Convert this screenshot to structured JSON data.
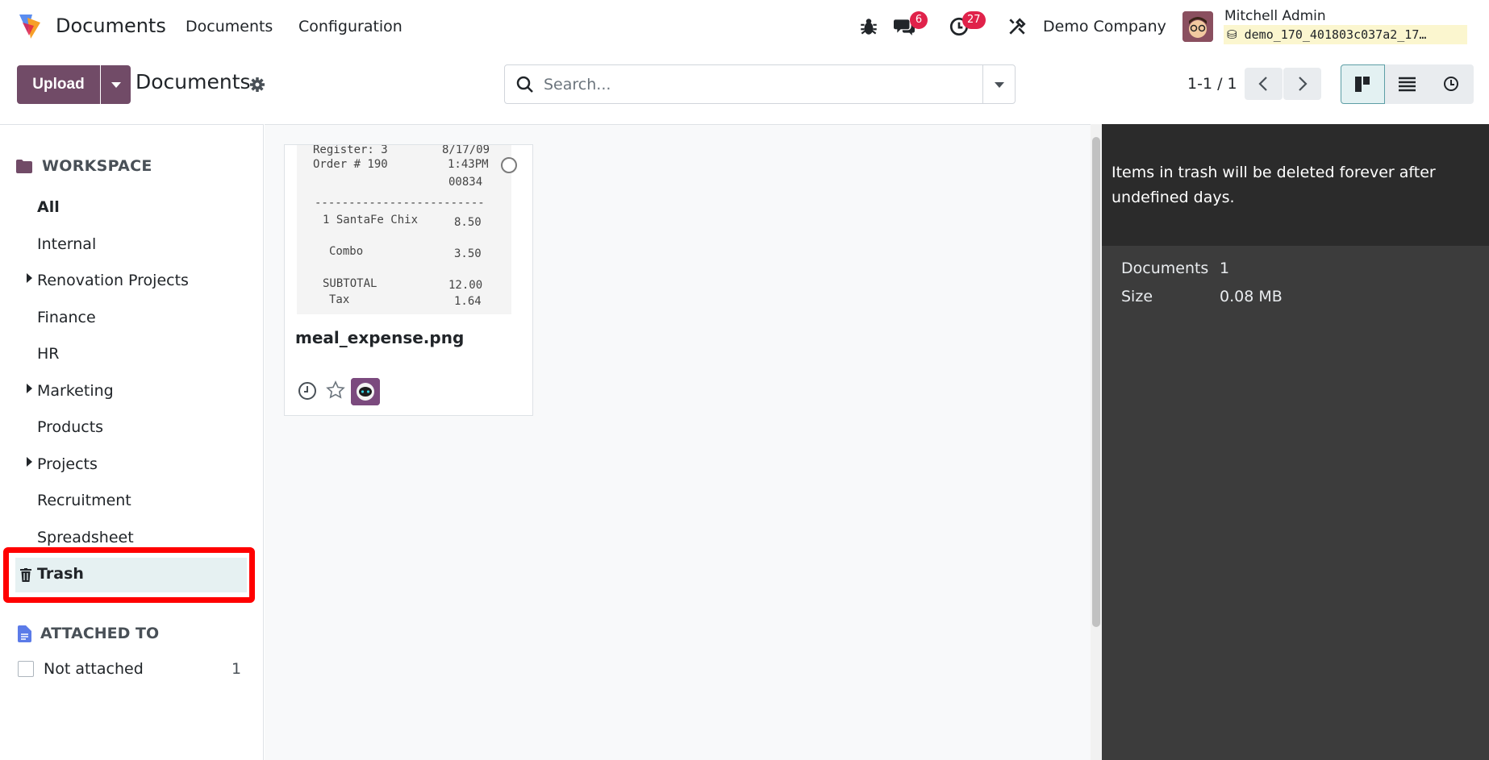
{
  "app": {
    "name": "Documents"
  },
  "nav": {
    "menu_documents": "Documents",
    "menu_configuration": "Configuration"
  },
  "systray": {
    "messages_count": "6",
    "activities_count": "27",
    "company": "Demo Company",
    "user_name": "Mitchell Admin",
    "db_name": "demo_170_401803c037a2_17…"
  },
  "control": {
    "upload_label": "Upload",
    "breadcrumb": "Documents",
    "search_placeholder": "Search...",
    "pager": "1-1 / 1"
  },
  "sidebar": {
    "workspace_header": "WORKSPACE",
    "items": [
      "All",
      "Internal",
      "Renovation Projects",
      "Finance",
      "HR",
      "Marketing",
      "Products",
      "Projects",
      "Recruitment",
      "Spreadsheet"
    ],
    "trash_label": "Trash",
    "attached_header": "ATTACHED TO",
    "not_attached_label": "Not attached",
    "not_attached_count": "1"
  },
  "document": {
    "name": "meal_expense.png",
    "receipt": {
      "line1_left": "Register: 3",
      "line1_right": "8/17/09",
      "line2_left": "Order # 190",
      "line2_right": "1:43PM",
      "line3_right": "00834",
      "separator": "-------------------------",
      "item1": "1 SantaFe Chix",
      "item1_price": "8.50",
      "item2": "Combo",
      "item2_price": "3.50",
      "subtotal": "SUBTOTAL",
      "subtotal_price": "12.00",
      "tax": "Tax",
      "tax_price": "1.64"
    }
  },
  "panel": {
    "trash_message": "Items in trash will be deleted forever after undefined days.",
    "documents_label": "Documents",
    "documents_value": "1",
    "size_label": "Size",
    "size_value": "0.08 MB"
  },
  "colors": {
    "brand": "#714b67",
    "badge": "#e0224a",
    "highlight": "#ff0000",
    "panel": "#3c3c3c"
  }
}
